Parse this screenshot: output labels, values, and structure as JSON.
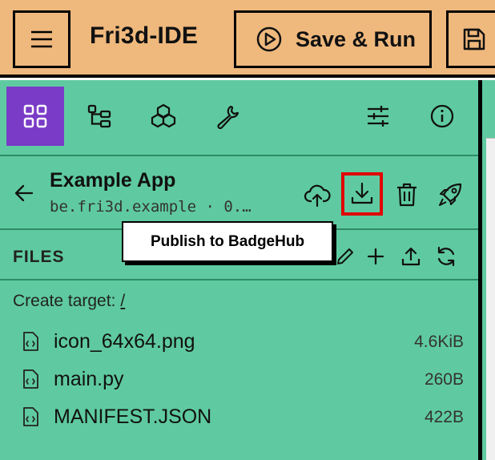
{
  "header": {
    "title": "Fri3d-IDE",
    "save_run_label": "Save & Run"
  },
  "toolbar": {
    "icons": [
      "grid-icon",
      "tree-icon",
      "packages-icon",
      "wrench-icon",
      "sliders-icon",
      "info-icon"
    ]
  },
  "app": {
    "name": "Example App",
    "id": "be.fri3d.example · 0.…"
  },
  "files_panel": {
    "label": "FILES",
    "create_target_label": "Create target:",
    "create_target_path": "/"
  },
  "files": [
    {
      "name": "icon_64x64.png",
      "size": "4.6KiB"
    },
    {
      "name": "main.py",
      "size": "260B"
    },
    {
      "name": "MANIFEST.JSON",
      "size": "422B"
    }
  ],
  "tooltip": {
    "text": "Publish to BadgeHub"
  },
  "colors": {
    "header_bg": "#efb87d",
    "panel_bg": "#5fcaa1",
    "active_tab": "#7a3bc7",
    "highlight": "#e00000"
  }
}
